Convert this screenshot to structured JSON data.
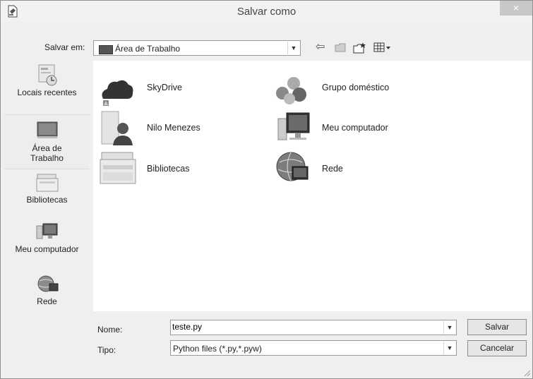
{
  "window": {
    "title": "Salvar como",
    "close_label": "×"
  },
  "toolbar": {
    "save_in_label": "Salvar em:",
    "save_in_value": "Área de Trabalho",
    "back_icon": "back-arrow-icon",
    "up_icon": "up-folder-icon",
    "new_folder_icon": "new-folder-icon",
    "view_icon": "view-menu-icon"
  },
  "places": [
    {
      "label": "Locais recentes",
      "icon": "recent-places-icon"
    },
    {
      "label_line1": "Área de",
      "label_line2": "Trabalho",
      "icon": "desktop-icon",
      "selected": true
    },
    {
      "label": "Bibliotecas",
      "icon": "libraries-icon"
    },
    {
      "label": "Meu computador",
      "icon": "computer-icon"
    },
    {
      "label": "Rede",
      "icon": "network-icon"
    }
  ],
  "items": [
    {
      "label": "SkyDrive",
      "icon": "skydrive-cloud-icon"
    },
    {
      "label": "Grupo doméstico",
      "icon": "homegroup-icon"
    },
    {
      "label": "Nilo Menezes",
      "icon": "user-folder-icon"
    },
    {
      "label": "Meu computador",
      "icon": "computer-icon"
    },
    {
      "label": "Bibliotecas",
      "icon": "libraries-folder-icon"
    },
    {
      "label": "Rede",
      "icon": "network-globe-icon"
    }
  ],
  "form": {
    "name_label": "Nome:",
    "name_value": "teste.py",
    "type_label": "Tipo:",
    "type_value": "Python files (*.py,*.pyw)",
    "save_button": "Salvar",
    "cancel_button": "Cancelar"
  }
}
